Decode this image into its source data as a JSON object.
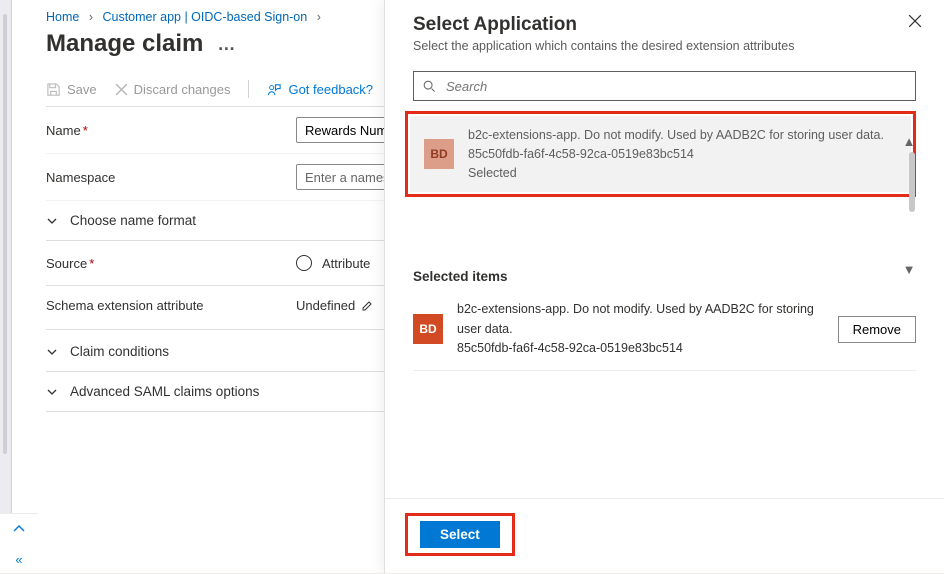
{
  "breadcrumb": {
    "home": "Home",
    "page": "Customer app | OIDC-based Sign-on"
  },
  "page_title": "Manage claim",
  "toolbar": {
    "save": "Save",
    "discard": "Discard changes",
    "feedback": "Got feedback?"
  },
  "fields": {
    "name_label": "Name",
    "name_value": "Rewards Number",
    "namespace_label": "Namespace",
    "namespace_placeholder": "Enter a namespace",
    "choose_name_format": "Choose name format",
    "source_label": "Source",
    "source_value": "Attribute",
    "schema_label": "Schema extension attribute",
    "schema_value": "Undefined",
    "claim_conditions": "Claim conditions",
    "advanced_saml": "Advanced SAML claims options"
  },
  "blade": {
    "title": "Select Application",
    "subtitle": "Select the application which contains the desired extension attributes",
    "search_placeholder": "Search",
    "result": {
      "initials": "BD",
      "line1": "b2c-extensions-app. Do not modify. Used by AADB2C for storing user data.",
      "line2": "85c50fdb-fa6f-4c58-92ca-0519e83bc514",
      "line3": "Selected"
    },
    "selected_heading": "Selected items",
    "selected": {
      "initials": "BD",
      "line1": "b2c-extensions-app. Do not modify. Used by AADB2C for storing user data.",
      "line2": "85c50fdb-fa6f-4c58-92ca-0519e83bc514"
    },
    "remove_label": "Remove",
    "select_label": "Select"
  }
}
